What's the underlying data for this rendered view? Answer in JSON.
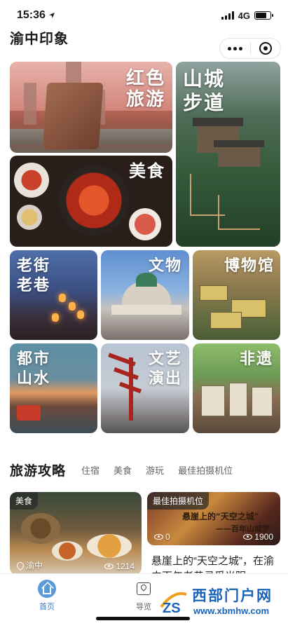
{
  "status_bar": {
    "time": "15:36",
    "network": "4G"
  },
  "header": {
    "title": "渝中印象"
  },
  "tiles": [
    {
      "label": [
        "红色",
        "旅游"
      ]
    },
    {
      "label": [
        "山城",
        "步道"
      ]
    },
    {
      "label": [
        "美食"
      ]
    },
    {
      "label": [
        "老街",
        "老巷"
      ]
    },
    {
      "label": [
        "文物"
      ]
    },
    {
      "label": [
        "博物馆"
      ]
    },
    {
      "label": [
        "都市",
        "山水"
      ]
    },
    {
      "label": [
        "文艺",
        "演出"
      ]
    },
    {
      "label": [
        "非遗"
      ]
    }
  ],
  "guide": {
    "title": "旅游攻略",
    "tabs": [
      "住宿",
      "美食",
      "游玩",
      "最佳拍摄机位"
    ]
  },
  "cards": [
    {
      "tag": "美食",
      "location": "渝中",
      "views": "1214"
    },
    {
      "tag": "最佳拍摄机位",
      "overlay_line1": "悬崖上的“天空之城”",
      "overlay_line2": "——百年山城梦",
      "views_left": "0",
      "views_right": "1900",
      "title": "悬崖上的“天空之城”，在渝中百年老巷寻觅光阴"
    }
  ],
  "tabbar": {
    "items": [
      {
        "label": "首页"
      },
      {
        "label": "导览"
      }
    ]
  },
  "watermark": {
    "cn": "西部门户网",
    "url": "www.xbmhw.com",
    "logo_text": "ZS"
  },
  "colors": {
    "accent": "#5b9ad8",
    "watermark": "#1a63b8"
  }
}
